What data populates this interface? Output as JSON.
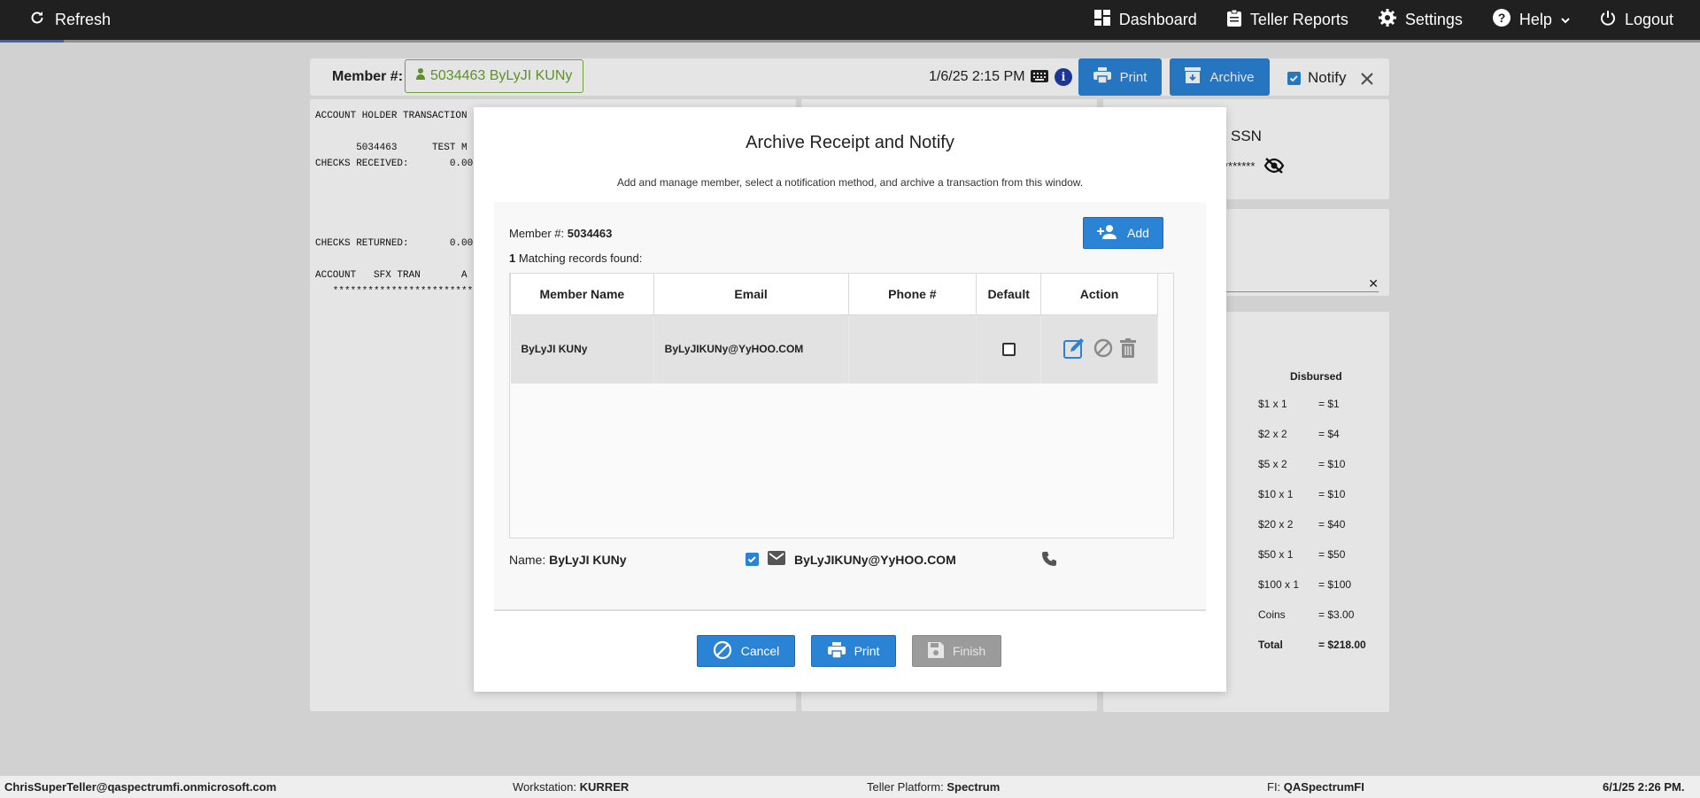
{
  "topbar": {
    "refresh_label": "Refresh",
    "nav": {
      "dashboard": "Dashboard",
      "teller_reports": "Teller Reports",
      "settings": "Settings",
      "help": "Help",
      "logout": "Logout"
    }
  },
  "member_bar": {
    "label": "Member #:",
    "member_tag": "5034463 ByLyJI KUNy",
    "datetime": "1/6/25 2:15 PM",
    "print_label": "Print",
    "archive_label": "Archive",
    "notify_label": "Notify"
  },
  "receipt": {
    "lines": [
      "ACCOUNT HOLDER TRANSACTION",
      "",
      "       5034463      TEST M",
      "CHECKS RECEIVED:       0.00",
      "",
      "",
      "",
      "",
      "CHECKS RETURNED:       0.00",
      "",
      "ACCOUNT   SFX TRAN       A",
      "   **************************"
    ]
  },
  "ssn_panel": {
    "title": "SSN",
    "masked": "*******"
  },
  "cash": {
    "header": "Disbursed",
    "rows": [
      {
        "denom": "$1 x 1",
        "value": "= $1"
      },
      {
        "denom": "$2 x 2",
        "value": "= $4"
      },
      {
        "denom": "$5 x 2",
        "value": "= $10"
      },
      {
        "denom": "$10 x 1",
        "value": "= $10"
      },
      {
        "denom": "$20 x 2",
        "value": "= $40"
      },
      {
        "denom": "$50 x 1",
        "value": "= $50"
      },
      {
        "denom": "$100 x 1",
        "value": "= $100"
      },
      {
        "denom": "Coins",
        "value": "= $3.00"
      },
      {
        "denom": "Total",
        "value": "= $218.00"
      }
    ]
  },
  "modal": {
    "title": "Archive Receipt and Notify",
    "subtitle": "Add and manage member, select a notification method, and archive a transaction from this window.",
    "member_label": "Member #:",
    "member_number": "5034463",
    "match_count": "1",
    "match_text": "Matching records found:",
    "add_label": "Add",
    "columns": [
      "Member Name",
      "Email",
      "Phone #",
      "Default",
      "Action"
    ],
    "rows": [
      {
        "name": "ByLyJI KUNy",
        "email": "ByLyJIKUNy@YyHOO.COM",
        "phone": "",
        "default": false
      }
    ],
    "name_label": "Name:",
    "name_value": "ByLyJI KUNy",
    "notify_email": "ByLyJIKUNy@YyHOO.COM",
    "cancel_label": "Cancel",
    "print_label": "Print",
    "finish_label": "Finish"
  },
  "footer": {
    "user": "ChrisSuperTeller@qaspectrumfi.onmicrosoft.com",
    "workstation_label": "Workstation:",
    "workstation": "KURRER",
    "platform_label": "Teller Platform:",
    "platform": "Spectrum",
    "fi_label": "FI:",
    "fi": "QASpectrumFI",
    "datetime": "6/1/25 2:26 PM."
  },
  "colors": {
    "accent": "#2b83d6",
    "topbar": "#202020",
    "member_tag": "#6aa22d",
    "disabled": "#9b9b9b"
  }
}
